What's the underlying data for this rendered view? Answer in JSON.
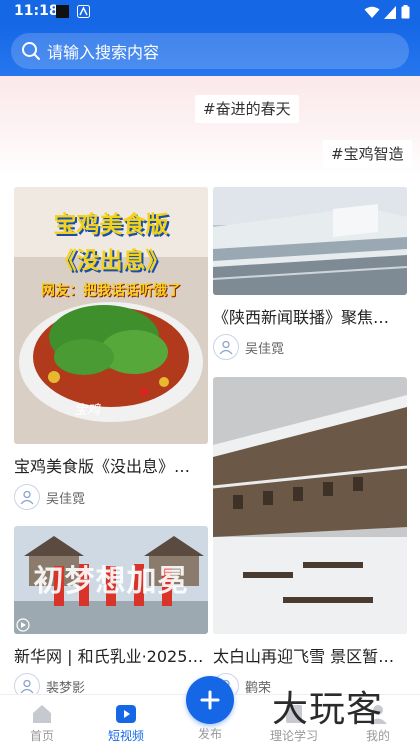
{
  "status": {
    "time": "11:18"
  },
  "search": {
    "placeholder": "请输入搜索内容"
  },
  "banner": {
    "tags": [
      "#奋进的春天",
      "#宝鸡智造"
    ]
  },
  "cards": [
    {
      "title": "宝鸡美食版《没出息》…",
      "author": "吴佳霓",
      "overlay": {
        "line1": "宝鸡美食版",
        "line2": "《没出息》",
        "line3": "网友：把我话话听饿了",
        "logo": "宝鸡"
      }
    },
    {
      "title": "《陕西新闻联播》聚焦…",
      "author": "吴佳霓"
    },
    {
      "title": "太白山再迎飞雪 景区暂…",
      "author": "鹳荣"
    },
    {
      "title": "新华网 | 和氏乳业·2025…",
      "author": "裴梦影",
      "overlay": {
        "text": "初梦想加冕"
      }
    }
  ],
  "nav": {
    "items": [
      "首页",
      "短视频",
      "发布",
      "理论学习",
      "我的"
    ],
    "active": "短视频"
  },
  "watermark": "大玩客",
  "colors": {
    "primary": "#1667e6"
  }
}
